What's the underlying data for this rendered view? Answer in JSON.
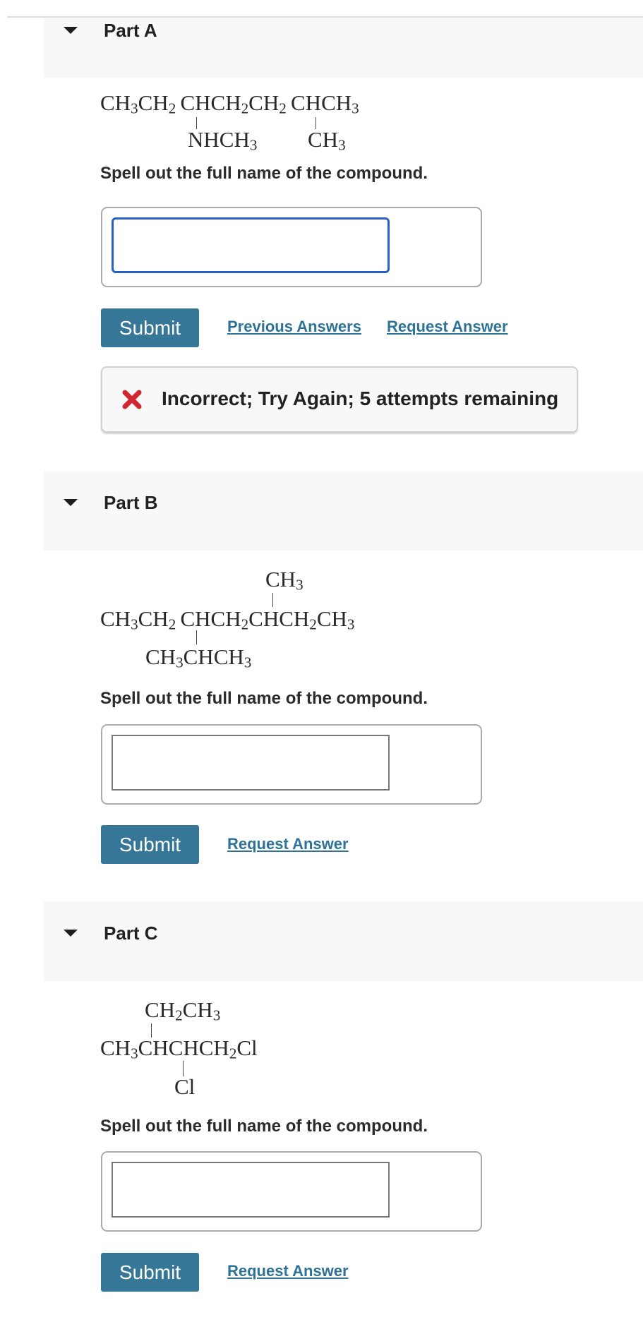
{
  "parts": [
    {
      "title": "Part A",
      "formula": {
        "main": [
          "CH",
          "3",
          "CH",
          "2",
          "CHCH",
          "2",
          "CH",
          "2",
          "CHCH",
          "3"
        ],
        "sub1": [
          "NHCH",
          "3"
        ],
        "sub2": [
          "CH",
          "3"
        ]
      },
      "prompt": "Spell out the full name of the compound.",
      "input_value": "",
      "submit_label": "Submit",
      "links": [
        "Previous Answers",
        "Request Answer"
      ],
      "feedback": {
        "icon": "x-mark-icon",
        "text": "Incorrect; Try Again; 5 attempts remaining",
        "color": "#d0282e"
      }
    },
    {
      "title": "Part B",
      "formula": {
        "top": [
          "CH",
          "3"
        ],
        "main": [
          "CH",
          "3",
          "CH",
          "2",
          "CHCH",
          "2",
          "CHCH",
          "2",
          "CH",
          "3"
        ],
        "bottom": [
          "CH",
          "3",
          "CHCH",
          "3"
        ]
      },
      "prompt": "Spell out the full name of the compound.",
      "input_value": "",
      "submit_label": "Submit",
      "links": [
        "Request Answer"
      ]
    },
    {
      "title": "Part C",
      "formula": {
        "top": [
          "CH",
          "2",
          "CH",
          "3"
        ],
        "main": [
          "CH",
          "3",
          "CHCHCH",
          "2",
          "Cl"
        ],
        "bottom": [
          "Cl"
        ]
      },
      "prompt": "Spell out the full name of the compound.",
      "input_value": "",
      "submit_label": "Submit",
      "links": [
        "Request Answer"
      ]
    }
  ],
  "colors": {
    "submit_bg": "#367697",
    "link": "#2e7397",
    "focus_border": "#2a60c6",
    "error": "#d0282e",
    "band_bg": "#f8f8f8"
  }
}
